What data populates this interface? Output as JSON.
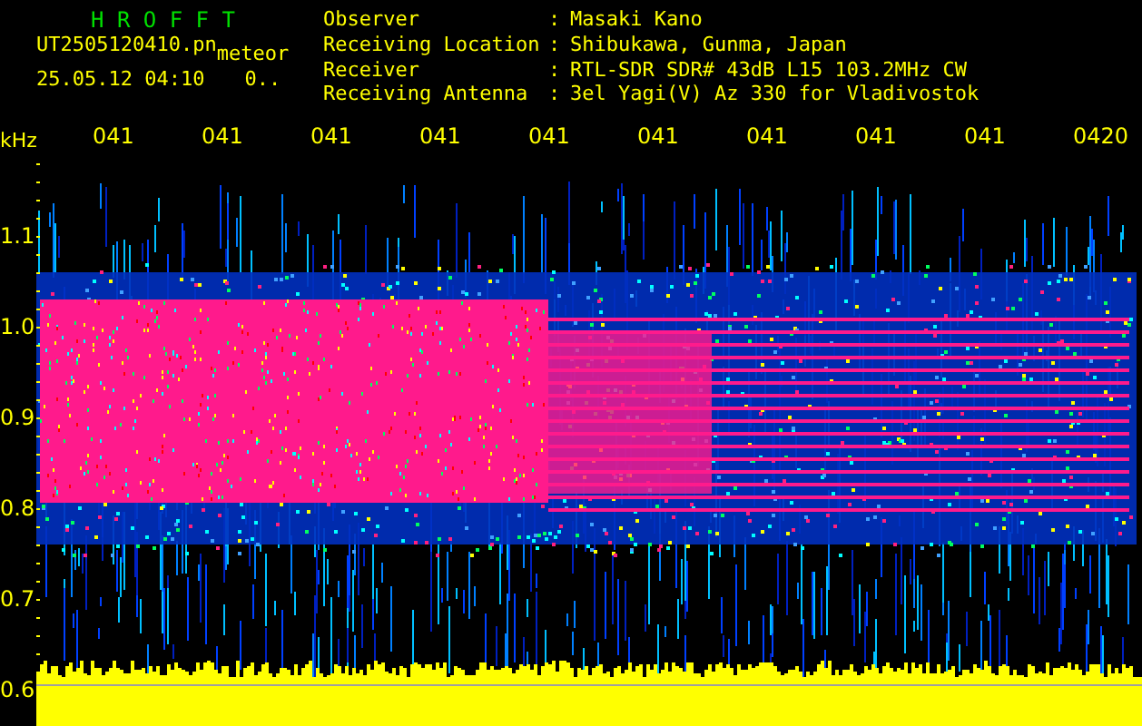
{
  "app_title": "H R O F F T",
  "file": {
    "name": "UT2505120410.pn",
    "tag": "meteor",
    "date": "25.05.12 04:10",
    "count": "0.."
  },
  "station": [
    {
      "label": "Observer",
      "separator": ":",
      "value": "Masaki Kano"
    },
    {
      "label": "Receiving Location",
      "separator": ":",
      "value": "Shibukawa, Gunma, Japan"
    },
    {
      "label": "Receiver",
      "separator": ":",
      "value": "RTL-SDR SDR# 43dB L15 103.2MHz CW"
    },
    {
      "label": "Receiving Antenna",
      "separator": ":",
      "value": "3el Yagi(V) Az 330 for Vladivostok"
    }
  ],
  "spectrogram": {
    "unit": "kHz",
    "time_labels": [
      "041",
      "041",
      "041",
      "041",
      "041",
      "041",
      "041",
      "041",
      "041",
      "0420"
    ],
    "freq_labels": [
      "1.1",
      "1.0",
      "0.9",
      "0.8",
      "0.7",
      "0.6"
    ]
  }
}
